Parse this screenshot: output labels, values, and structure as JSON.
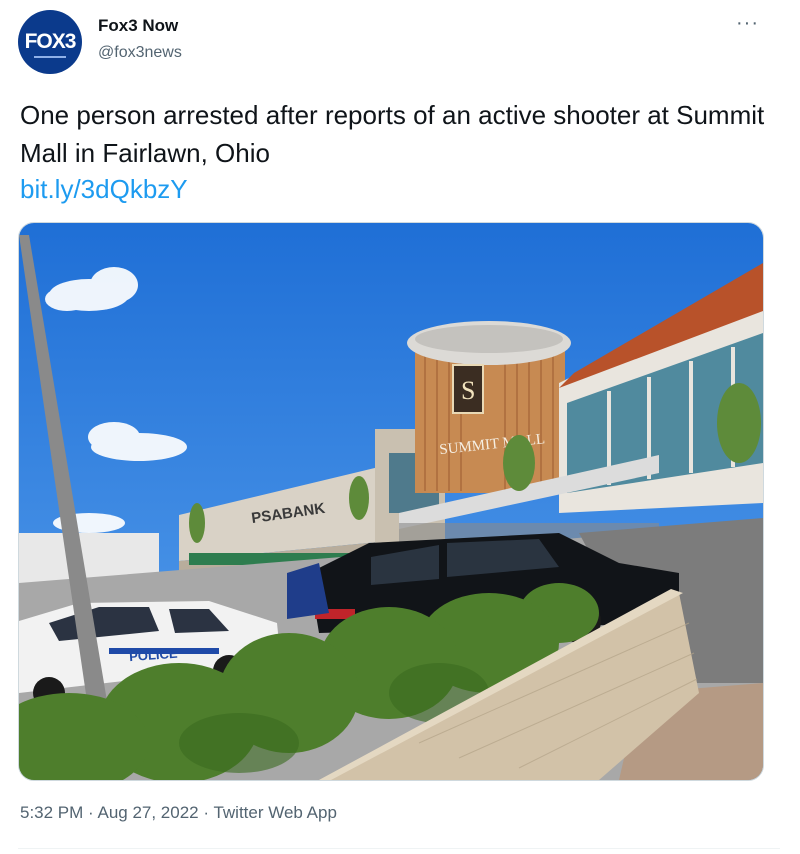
{
  "author": {
    "display_name": "Fox3 Now",
    "handle": "@fox3news",
    "avatar_label": "FOX3"
  },
  "more_label": "···",
  "tweet": {
    "text": "One person arrested after reports of an active shooter at Summit Mall in Fairlawn, Ohio",
    "link": "bit.ly/3dQkbzY"
  },
  "photo": {
    "signs": {
      "bank": "PSABANK",
      "mall": "SUMMIT MALL",
      "logo": "S",
      "police": "POLICE"
    }
  },
  "meta": {
    "time": "5:32 PM",
    "sep1": " · ",
    "date": "Aug 27, 2022",
    "sep2": " · ",
    "source": "Twitter Web App"
  },
  "colors": {
    "link": "#1d9bf0",
    "secondary_text": "#536471",
    "sky": "#2f7de0",
    "avatar_bg": "#0b3a8c"
  }
}
